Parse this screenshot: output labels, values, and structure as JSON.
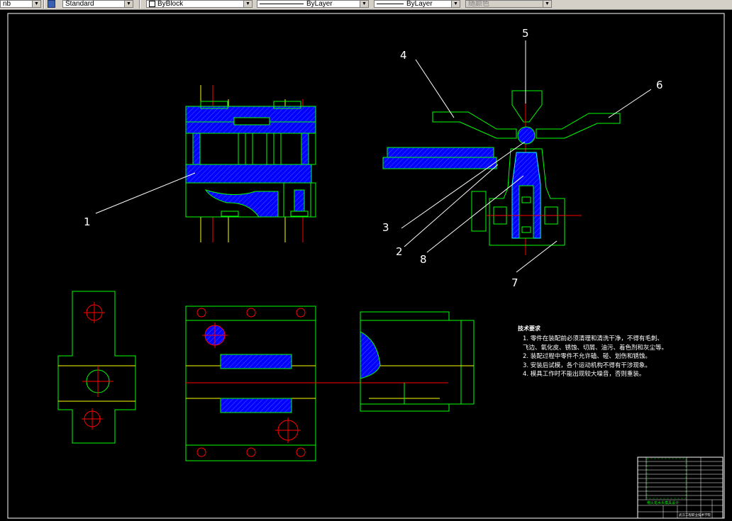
{
  "toolbar": {
    "controls": [
      {
        "text": "nb"
      },
      {
        "text": "Standard"
      },
      {
        "text": "ByBlock"
      },
      {
        "text": "ByLayer"
      },
      {
        "text": "ByLayer"
      },
      {
        "text": "随颜色"
      }
    ]
  },
  "drawing": {
    "balloons": [
      "1",
      "2",
      "3",
      "4",
      "5",
      "6",
      "7",
      "8"
    ]
  },
  "notes": {
    "title": "技术要求",
    "items": [
      "1. 零件在装配前必须清理和清洗干净，不得有毛刺、",
      "飞边、氧化皮、锈蚀、切屑、油污、着色剂和灰尘等。",
      "2. 装配过程中零件不允许磕、碰、划伤和锈蚀。",
      "3. 安装后试模，各个运动机构不得有干涉现象。",
      "4. 模具工作时不能出现较大噪音，否则重装。"
    ]
  },
  "title_block": {
    "drawing_title": "电火花水头模具设计",
    "school": "武汉工程职业技术学院"
  },
  "colors": {
    "outline": "#00ff00",
    "hatch": "#0000ff",
    "center": "#ff0000",
    "axis": "#ffff00",
    "leader": "#ffffff",
    "cyan": "#00ffff"
  }
}
